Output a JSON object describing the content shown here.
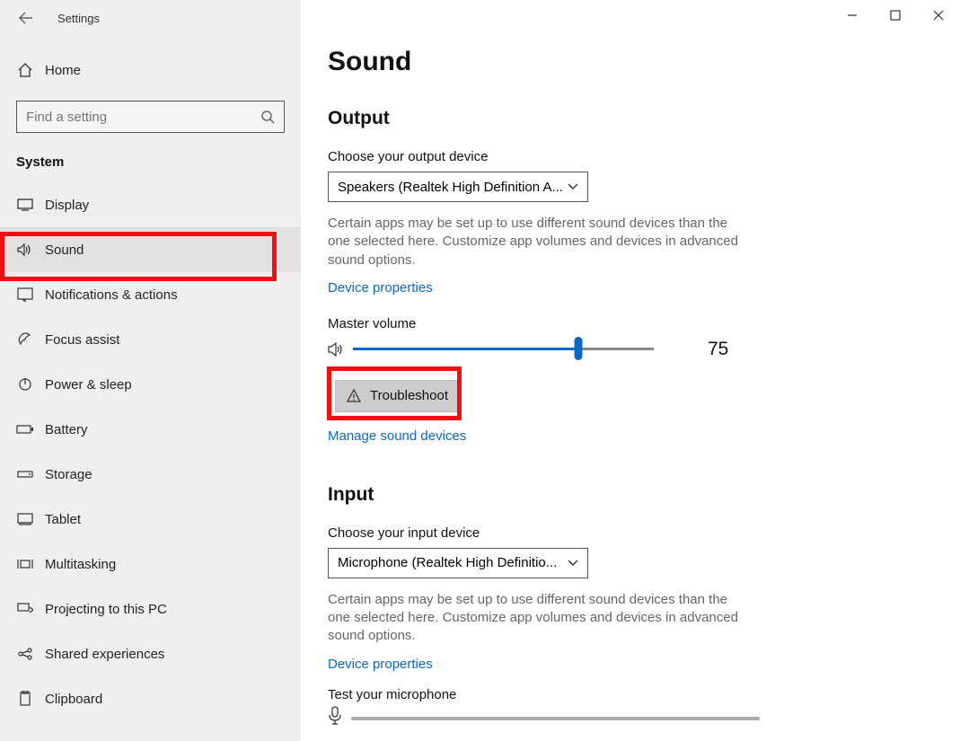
{
  "window": {
    "title": "Settings"
  },
  "sidebar": {
    "home_label": "Home",
    "search_placeholder": "Find a setting",
    "section_label": "System",
    "items": [
      {
        "label": "Display"
      },
      {
        "label": "Sound"
      },
      {
        "label": "Notifications & actions"
      },
      {
        "label": "Focus assist"
      },
      {
        "label": "Power & sleep"
      },
      {
        "label": "Battery"
      },
      {
        "label": "Storage"
      },
      {
        "label": "Tablet"
      },
      {
        "label": "Multitasking"
      },
      {
        "label": "Projecting to this PC"
      },
      {
        "label": "Shared experiences"
      },
      {
        "label": "Clipboard"
      }
    ]
  },
  "main": {
    "page_title": "Sound",
    "output": {
      "heading": "Output",
      "choose_label": "Choose your output device",
      "selected_device": "Speakers (Realtek High Definition A...",
      "helper_text": "Certain apps may be set up to use different sound devices than the one selected here. Customize app volumes and devices in advanced sound options.",
      "device_properties": "Device properties",
      "master_volume_label": "Master volume",
      "master_volume_value": "75",
      "troubleshoot_label": "Troubleshoot",
      "manage_link": "Manage sound devices"
    },
    "input": {
      "heading": "Input",
      "choose_label": "Choose your input device",
      "selected_device": "Microphone (Realtek High Definitio...",
      "helper_text": "Certain apps may be set up to use different sound devices than the one selected here. Customize app volumes and devices in advanced sound options.",
      "device_properties": "Device properties",
      "test_mic_label": "Test your microphone"
    }
  }
}
